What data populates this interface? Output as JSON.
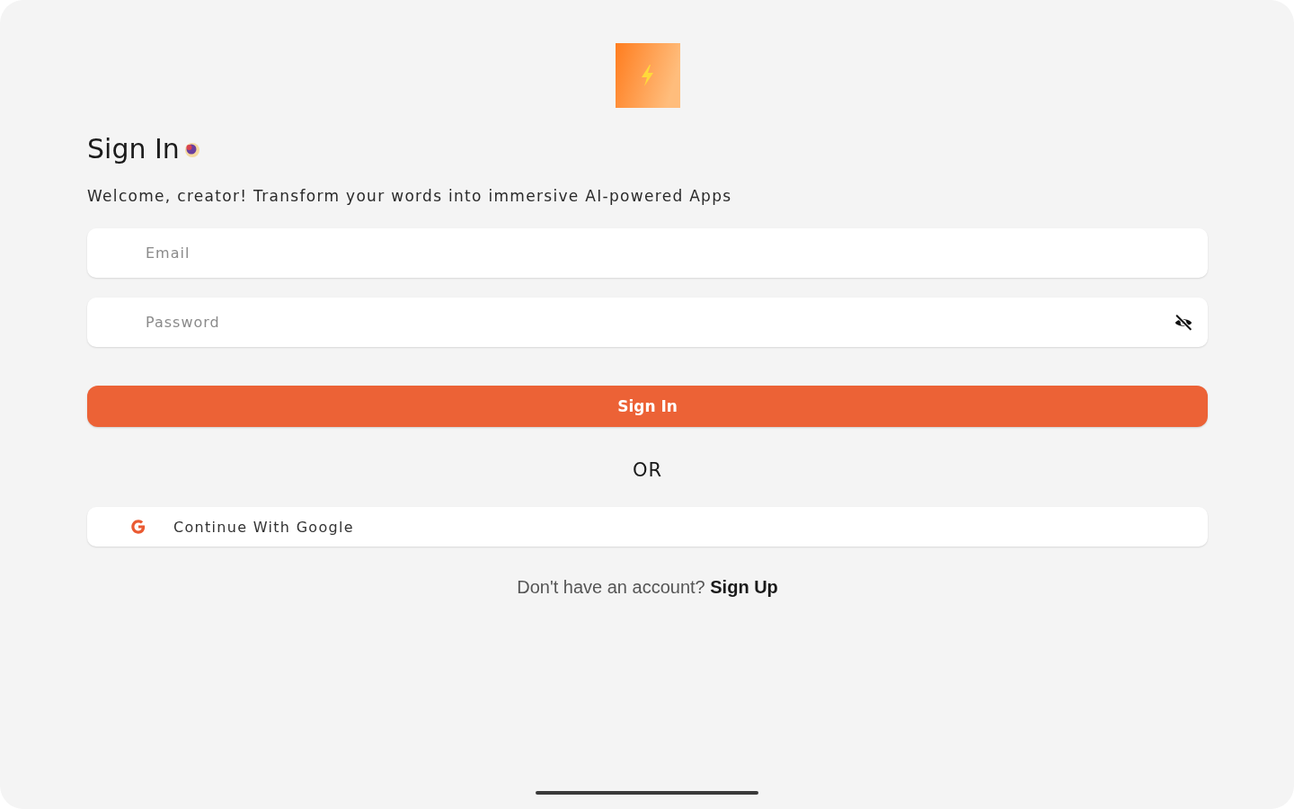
{
  "title": "Sign In",
  "subtitle": "Welcome, creator! Transform your words into immersive AI-powered Apps",
  "fields": [
    {
      "kind": "email",
      "placeholder": "Email"
    },
    {
      "kind": "password",
      "placeholder": "Password"
    }
  ],
  "primary_button": "Sign In",
  "divider": "OR",
  "social_buttons": [
    {
      "kind": "google",
      "label": "Continue With Google"
    }
  ],
  "footer": {
    "prompt": "Don't have an account?",
    "link": "Sign Up"
  }
}
